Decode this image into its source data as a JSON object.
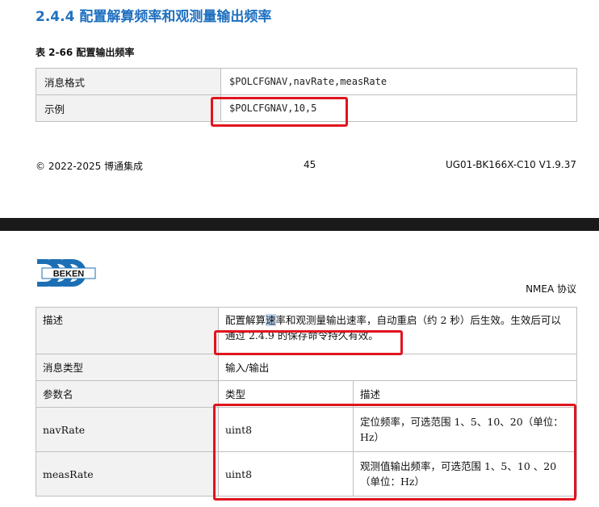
{
  "page1": {
    "section_title": "2.4.4 配置解算频率和观测量输出频率",
    "table_caption": "表 2-66 配置输出频率",
    "rows": [
      {
        "label": "消息格式",
        "value": "$POLCFGNAV,navRate,measRate"
      },
      {
        "label": "示例",
        "value": "$POLCFGNAV,10,5"
      }
    ],
    "footer": {
      "left": "© 2022-2025 博通集成",
      "page_number": "45",
      "right": "UG01-BK166X-C10 V1.9.37"
    }
  },
  "page2": {
    "logo_text": "BEKEN",
    "header_right": "NMEA 协议",
    "table": {
      "desc_label": "描述",
      "desc_part1": "配置解算",
      "desc_hl": "速",
      "desc_part2": "率和观测量输出速率，自动重启（约 2 秒）后生效。生效后可以通过 2.4.9 的保存命令持久有效。",
      "msg_type_label": "消息类型",
      "msg_type_value": "输入/输出",
      "param_header": {
        "name": "参数名",
        "type": "类型",
        "desc": "描述"
      },
      "params": [
        {
          "name": "navRate",
          "type": "uint8",
          "desc": "定位频率，可选范围 1、5、10、20（单位：Hz）"
        },
        {
          "name": "measRate",
          "type": "uint8",
          "desc": "观测值输出频率，可选范围 1、5、10 、20（单位：Hz）"
        }
      ]
    }
  },
  "colors": {
    "title_blue": "#1f70c0",
    "highlight_red": "#e0141e",
    "logo_blue": "#1c6fb5"
  }
}
